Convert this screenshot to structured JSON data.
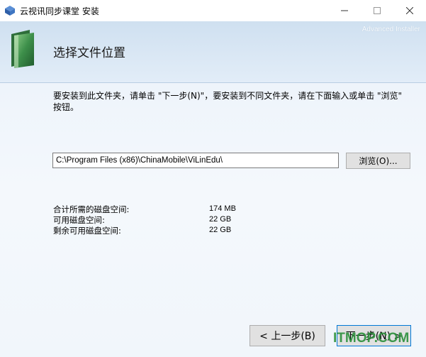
{
  "window": {
    "title": "云视讯同步课堂 安装",
    "controls": {
      "minimize": "—",
      "maximize": "☐",
      "close": "✕"
    }
  },
  "header": {
    "brand": "Advanced Installer",
    "page_title": "选择文件位置"
  },
  "main": {
    "description": "要安装到此文件夹，请单击 \"下一步(N)\"，要安装到不同文件夹，请在下面输入或单击 \"浏览\" 按钮。",
    "path_value": "C:\\Program Files (x86)\\ChinaMobile\\ViLinEdu\\",
    "browse_label": "浏览(O)...",
    "disk_info": [
      {
        "label": "合计所需的磁盘空间:",
        "value": "174 MB"
      },
      {
        "label": "可用磁盘空间:",
        "value": "22 GB"
      },
      {
        "label": "剩余可用磁盘空间:",
        "value": "22 GB"
      }
    ]
  },
  "footer": {
    "back_label": "< 上一步(B)",
    "next_label": "下一步(N) >"
  },
  "watermark": "ITMOP.COM",
  "colors": {
    "accent": "#0078d7",
    "header_bg": "#d6e5f3",
    "watermark": "#2b8f3a"
  }
}
